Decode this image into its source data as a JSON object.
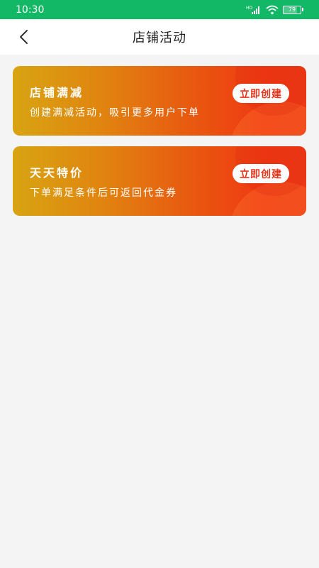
{
  "status_bar": {
    "time": "10:30",
    "network_label": "HD",
    "battery": "79",
    "battery_level": 0.79
  },
  "nav": {
    "title": "店铺活动"
  },
  "cards": [
    {
      "title": "店铺满减",
      "description": "创建满减活动，吸引更多用户下单",
      "button": "立即创建"
    },
    {
      "title": "天天特价",
      "description": "下单满足条件后可返回代金券",
      "button": "立即创建"
    }
  ],
  "colors": {
    "status_bar": "#12b865",
    "card_gradient_start": "#d8a412",
    "card_gradient_end": "#ee3a14",
    "button_text": "#e8341a",
    "background": "#f4f4f4"
  }
}
